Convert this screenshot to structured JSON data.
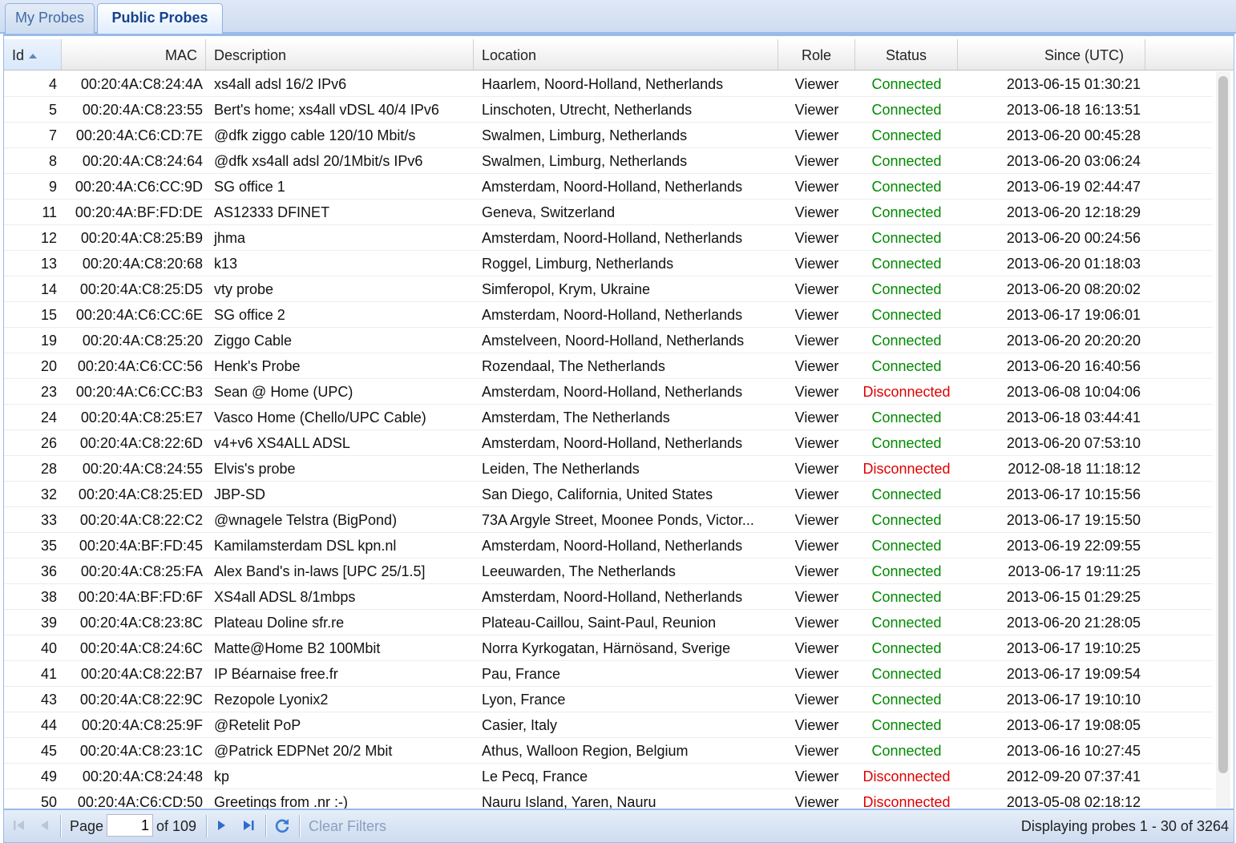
{
  "tabs": [
    {
      "label": "My Probes",
      "active": false
    },
    {
      "label": "Public Probes",
      "active": true
    }
  ],
  "columns": {
    "id": "Id",
    "mac": "MAC",
    "description": "Description",
    "location": "Location",
    "role": "Role",
    "status": "Status",
    "since": "Since (UTC)"
  },
  "rows": [
    {
      "id": "4",
      "mac": "00:20:4A:C8:24:4A",
      "description": "xs4all adsl 16/2 IPv6",
      "location": "Haarlem, Noord-Holland, Netherlands",
      "role": "Viewer",
      "status": "Connected",
      "since": "2013-06-15 01:30:21"
    },
    {
      "id": "5",
      "mac": "00:20:4A:C8:23:55",
      "description": "Bert's home; xs4all vDSL 40/4 IPv6",
      "location": "Linschoten, Utrecht, Netherlands",
      "role": "Viewer",
      "status": "Connected",
      "since": "2013-06-18 16:13:51"
    },
    {
      "id": "7",
      "mac": "00:20:4A:C6:CD:7E",
      "description": "@dfk ziggo cable 120/10 Mbit/s",
      "location": "Swalmen, Limburg, Netherlands",
      "role": "Viewer",
      "status": "Connected",
      "since": "2013-06-20 00:45:28"
    },
    {
      "id": "8",
      "mac": "00:20:4A:C8:24:64",
      "description": "@dfk xs4all adsl 20/1Mbit/s IPv6",
      "location": "Swalmen, Limburg, Netherlands",
      "role": "Viewer",
      "status": "Connected",
      "since": "2013-06-20 03:06:24"
    },
    {
      "id": "9",
      "mac": "00:20:4A:C6:CC:9D",
      "description": "SG office 1",
      "location": "Amsterdam, Noord-Holland, Netherlands",
      "role": "Viewer",
      "status": "Connected",
      "since": "2013-06-19 02:44:47"
    },
    {
      "id": "11",
      "mac": "00:20:4A:BF:FD:DE",
      "description": "AS12333 DFINET",
      "location": "Geneva, Switzerland",
      "role": "Viewer",
      "status": "Connected",
      "since": "2013-06-20 12:18:29"
    },
    {
      "id": "12",
      "mac": "00:20:4A:C8:25:B9",
      "description": "jhma",
      "location": "Amsterdam, Noord-Holland, Netherlands",
      "role": "Viewer",
      "status": "Connected",
      "since": "2013-06-20 00:24:56"
    },
    {
      "id": "13",
      "mac": "00:20:4A:C8:20:68",
      "description": "k13",
      "location": "Roggel, Limburg, Netherlands",
      "role": "Viewer",
      "status": "Connected",
      "since": "2013-06-20 01:18:03"
    },
    {
      "id": "14",
      "mac": "00:20:4A:C8:25:D5",
      "description": "vty probe",
      "location": "Simferopol, Krym, Ukraine",
      "role": "Viewer",
      "status": "Connected",
      "since": "2013-06-20 08:20:02"
    },
    {
      "id": "15",
      "mac": "00:20:4A:C6:CC:6E",
      "description": "SG office 2",
      "location": "Amsterdam, Noord-Holland, Netherlands",
      "role": "Viewer",
      "status": "Connected",
      "since": "2013-06-17 19:06:01"
    },
    {
      "id": "19",
      "mac": "00:20:4A:C8:25:20",
      "description": "Ziggo Cable",
      "location": "Amstelveen, Noord-Holland, Netherlands",
      "role": "Viewer",
      "status": "Connected",
      "since": "2013-06-20 20:20:20"
    },
    {
      "id": "20",
      "mac": "00:20:4A:C6:CC:56",
      "description": "Henk's Probe",
      "location": "Rozendaal, The Netherlands",
      "role": "Viewer",
      "status": "Connected",
      "since": "2013-06-20 16:40:56"
    },
    {
      "id": "23",
      "mac": "00:20:4A:C6:CC:B3",
      "description": "Sean @ Home (UPC)",
      "location": "Amsterdam, Noord-Holland, Netherlands",
      "role": "Viewer",
      "status": "Disconnected",
      "since": "2013-06-08 10:04:06"
    },
    {
      "id": "24",
      "mac": "00:20:4A:C8:25:E7",
      "description": "Vasco Home (Chello/UPC Cable)",
      "location": "Amsterdam, The Netherlands",
      "role": "Viewer",
      "status": "Connected",
      "since": "2013-06-18 03:44:41"
    },
    {
      "id": "26",
      "mac": "00:20:4A:C8:22:6D",
      "description": "v4+v6 XS4ALL ADSL",
      "location": "Amsterdam, Noord-Holland, Netherlands",
      "role": "Viewer",
      "status": "Connected",
      "since": "2013-06-20 07:53:10"
    },
    {
      "id": "28",
      "mac": "00:20:4A:C8:24:55",
      "description": "Elvis's probe",
      "location": "Leiden, The Netherlands",
      "role": "Viewer",
      "status": "Disconnected",
      "since": "2012-08-18 11:18:12"
    },
    {
      "id": "32",
      "mac": "00:20:4A:C8:25:ED",
      "description": "JBP-SD",
      "location": "San Diego, California, United States",
      "role": "Viewer",
      "status": "Connected",
      "since": "2013-06-17 10:15:56"
    },
    {
      "id": "33",
      "mac": "00:20:4A:C8:22:C2",
      "description": "@wnagele Telstra (BigPond)",
      "location": "73A Argyle Street, Moonee Ponds, Victor...",
      "role": "Viewer",
      "status": "Connected",
      "since": "2013-06-17 19:15:50"
    },
    {
      "id": "35",
      "mac": "00:20:4A:BF:FD:45",
      "description": "Kamilamsterdam DSL kpn.nl",
      "location": "Amsterdam, Noord-Holland, Netherlands",
      "role": "Viewer",
      "status": "Connected",
      "since": "2013-06-19 22:09:55"
    },
    {
      "id": "36",
      "mac": "00:20:4A:C8:25:FA",
      "description": "Alex Band's in-laws [UPC 25/1.5]",
      "location": "Leeuwarden, The Netherlands",
      "role": "Viewer",
      "status": "Connected",
      "since": "2013-06-17 19:11:25"
    },
    {
      "id": "38",
      "mac": "00:20:4A:BF:FD:6F",
      "description": "XS4all ADSL 8/1mbps",
      "location": "Amsterdam, Noord-Holland, Netherlands",
      "role": "Viewer",
      "status": "Connected",
      "since": "2013-06-15 01:29:25"
    },
    {
      "id": "39",
      "mac": "00:20:4A:C8:23:8C",
      "description": "Plateau Doline sfr.re",
      "location": "Plateau-Caillou, Saint-Paul, Reunion",
      "role": "Viewer",
      "status": "Connected",
      "since": "2013-06-20 21:28:05"
    },
    {
      "id": "40",
      "mac": "00:20:4A:C8:24:6C",
      "description": "Matte@Home B2 100Mbit",
      "location": "Norra Kyrkogatan, Härnösand, Sverige",
      "role": "Viewer",
      "status": "Connected",
      "since": "2013-06-17 19:10:25"
    },
    {
      "id": "41",
      "mac": "00:20:4A:C8:22:B7",
      "description": "IP Béarnaise free.fr",
      "location": "Pau, France",
      "role": "Viewer",
      "status": "Connected",
      "since": "2013-06-17 19:09:54"
    },
    {
      "id": "43",
      "mac": "00:20:4A:C8:22:9C",
      "description": "Rezopole Lyonix2",
      "location": "Lyon, France",
      "role": "Viewer",
      "status": "Connected",
      "since": "2013-06-17 19:10:10"
    },
    {
      "id": "44",
      "mac": "00:20:4A:C8:25:9F",
      "description": "@Retelit PoP",
      "location": "Casier, Italy",
      "role": "Viewer",
      "status": "Connected",
      "since": "2013-06-17 19:08:05"
    },
    {
      "id": "45",
      "mac": "00:20:4A:C8:23:1C",
      "description": "@Patrick EDPNet 20/2 Mbit",
      "location": "Athus, Walloon Region, Belgium",
      "role": "Viewer",
      "status": "Connected",
      "since": "2013-06-16 10:27:45"
    },
    {
      "id": "49",
      "mac": "00:20:4A:C8:24:48",
      "description": "kp",
      "location": "Le Pecq, France",
      "role": "Viewer",
      "status": "Disconnected",
      "since": "2012-09-20 07:37:41"
    },
    {
      "id": "50",
      "mac": "00:20:4A:C6:CD:50",
      "description": "Greetings from .nr :-)",
      "location": "Nauru Island, Yaren, Nauru",
      "role": "Viewer",
      "status": "Disconnected",
      "since": "2013-05-08 02:18:12"
    }
  ],
  "pager": {
    "page_label": "Page",
    "page_value": "1",
    "of_label": "of 109",
    "clear_filters": "Clear Filters",
    "display_text": "Displaying probes 1 - 30 of 3264",
    "icons": [
      "first-page-icon",
      "prev-page-icon",
      "next-page-icon",
      "last-page-icon",
      "refresh-icon"
    ]
  },
  "colors": {
    "connected": "#008a00",
    "disconnected": "#e00000",
    "frame": "#99bbe8"
  }
}
